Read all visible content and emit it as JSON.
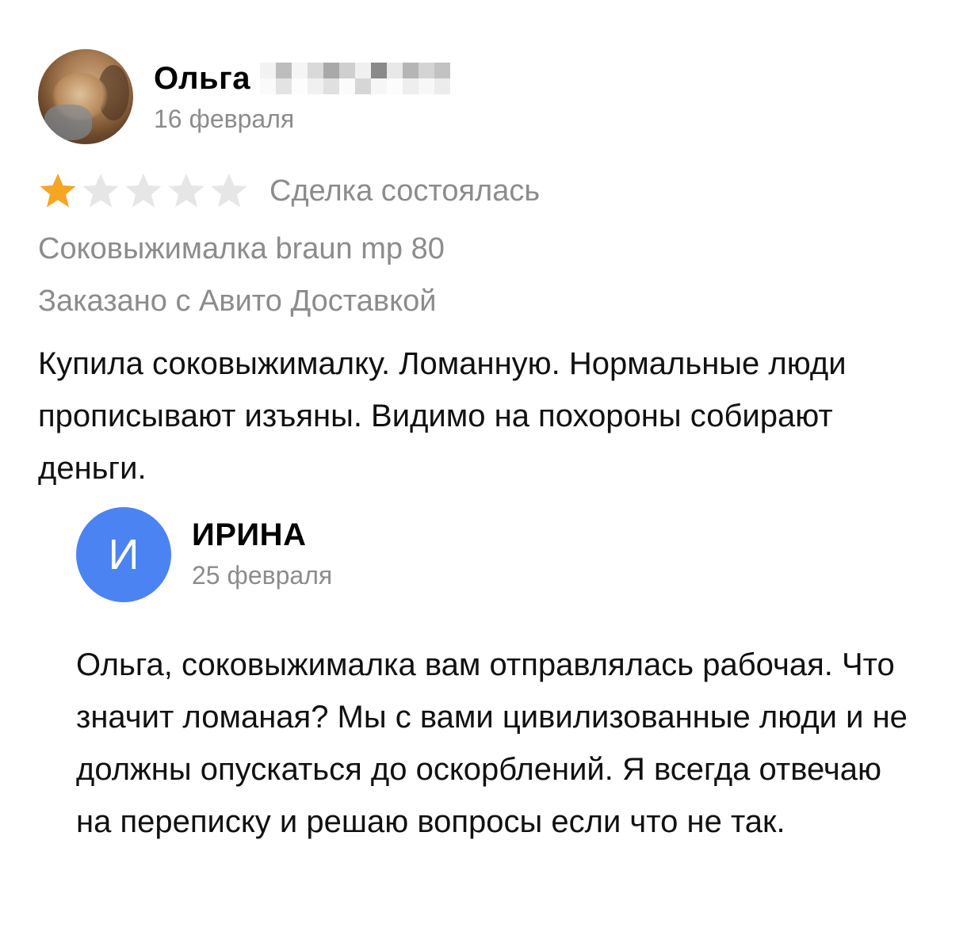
{
  "review": {
    "author_name": "Ольга",
    "date": "16 февраля",
    "rating": 1,
    "rating_max": 5,
    "deal_status": "Сделка состоялась",
    "product": "Соковыжималка braun mp 80",
    "delivery": "Заказано с Авито Доставкой",
    "text": "Купила соковыжималку. Ломанную. Нормальные люди прописывают изъяны. Видимо на похороны собирают деньги.",
    "star_filled_color": "#f5a623",
    "star_empty_color": "#e6e6e6"
  },
  "reply": {
    "avatar_letter": "И",
    "avatar_color": "#4c83f2",
    "author_name": "ИРИНА",
    "date": "25 февраля",
    "text": "Ольга, соковыжималка вам отправлялась рабочая. Что значит ломаная? Мы с вами цивилизованные люди и не должны опускаться до оскорблений. Я всегда отвечаю на переписку и решаю вопросы если что не так."
  }
}
